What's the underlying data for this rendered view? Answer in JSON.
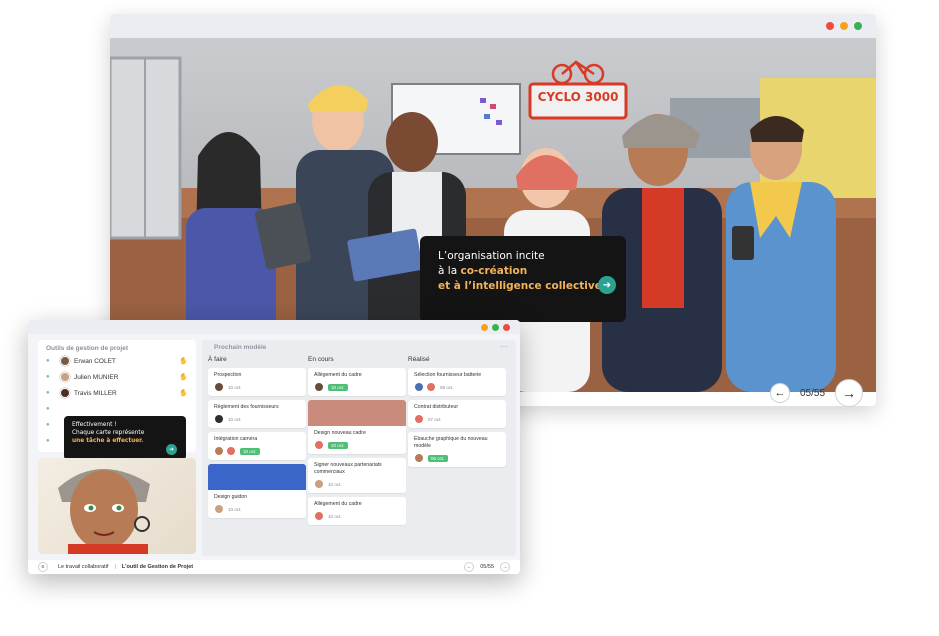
{
  "colors": {
    "red": "#ef4a3c",
    "orange": "#f6a21a",
    "green": "#37b24d",
    "teal": "#2aa393",
    "highlight": "#f4b35a",
    "tag_green": "#4cc074"
  },
  "scene": {
    "sign_text": "CYCLO 3000",
    "bubble": {
      "line1": "L’organisation incite",
      "line2_prefix": "à la ",
      "line2_highlight": "co-création",
      "line3": "et à l’intelligence collective.",
      "arrow_icon": "arrow-right-icon"
    },
    "pager": {
      "prev_icon": "arrow-left-icon",
      "next_icon": "arrow-right-icon",
      "count": "05/55"
    }
  },
  "app": {
    "team_panel": {
      "title": "Outils de gestion de projet",
      "members": [
        {
          "name": "Erwan COLET"
        },
        {
          "name": "Julien MUNIER"
        },
        {
          "name": "Travis MILLER"
        },
        {
          "name": ""
        },
        {
          "name": ""
        },
        {
          "name": ""
        }
      ]
    },
    "small_bubble": {
      "line1": "Effectivement !",
      "line2": "Chaque carte représente",
      "line3": "une tâche à effectuer."
    },
    "board": {
      "title": "Prochain modèle",
      "columns": [
        {
          "title": "À faire",
          "cards": [
            {
              "title": "Prospection",
              "date": "10 oct.",
              "tag": ""
            },
            {
              "title": "Règlement des fournisseurs",
              "date": "10 oct.",
              "tag": ""
            },
            {
              "title": "Intégration caméra",
              "date": "",
              "tag": "10 oct."
            },
            {
              "title": "Design guidon",
              "date": "10 oct.",
              "tag": ""
            }
          ]
        },
        {
          "title": "En cours",
          "cards": [
            {
              "title": "Allègement du cadre",
              "date": "",
              "tag": "10 oct."
            },
            {
              "title": "Design nouveau cadre",
              "date": "",
              "tag": "10 oct."
            },
            {
              "title": "Signer nouveaux partenariats commerciaux",
              "date": "10 oct.",
              "tag": ""
            },
            {
              "title": "Allègement du cadre",
              "date": "10 oct.",
              "tag": ""
            }
          ]
        },
        {
          "title": "Réalisé",
          "cards": [
            {
              "title": "Sélection fournisseur batterie",
              "date": "08 oct.",
              "tag": ""
            },
            {
              "title": "Contrat distributeur",
              "date": "07 oct.",
              "tag": ""
            },
            {
              "title": "Ébauche graphique du nouveau modèle",
              "date": "",
              "tag": "06 oct."
            }
          ]
        }
      ]
    },
    "footer": {
      "crumb1": "Le travail collaboratif",
      "separator": "|",
      "crumb2": "L’outil de Gestion de Projet",
      "count": "05/55"
    }
  }
}
